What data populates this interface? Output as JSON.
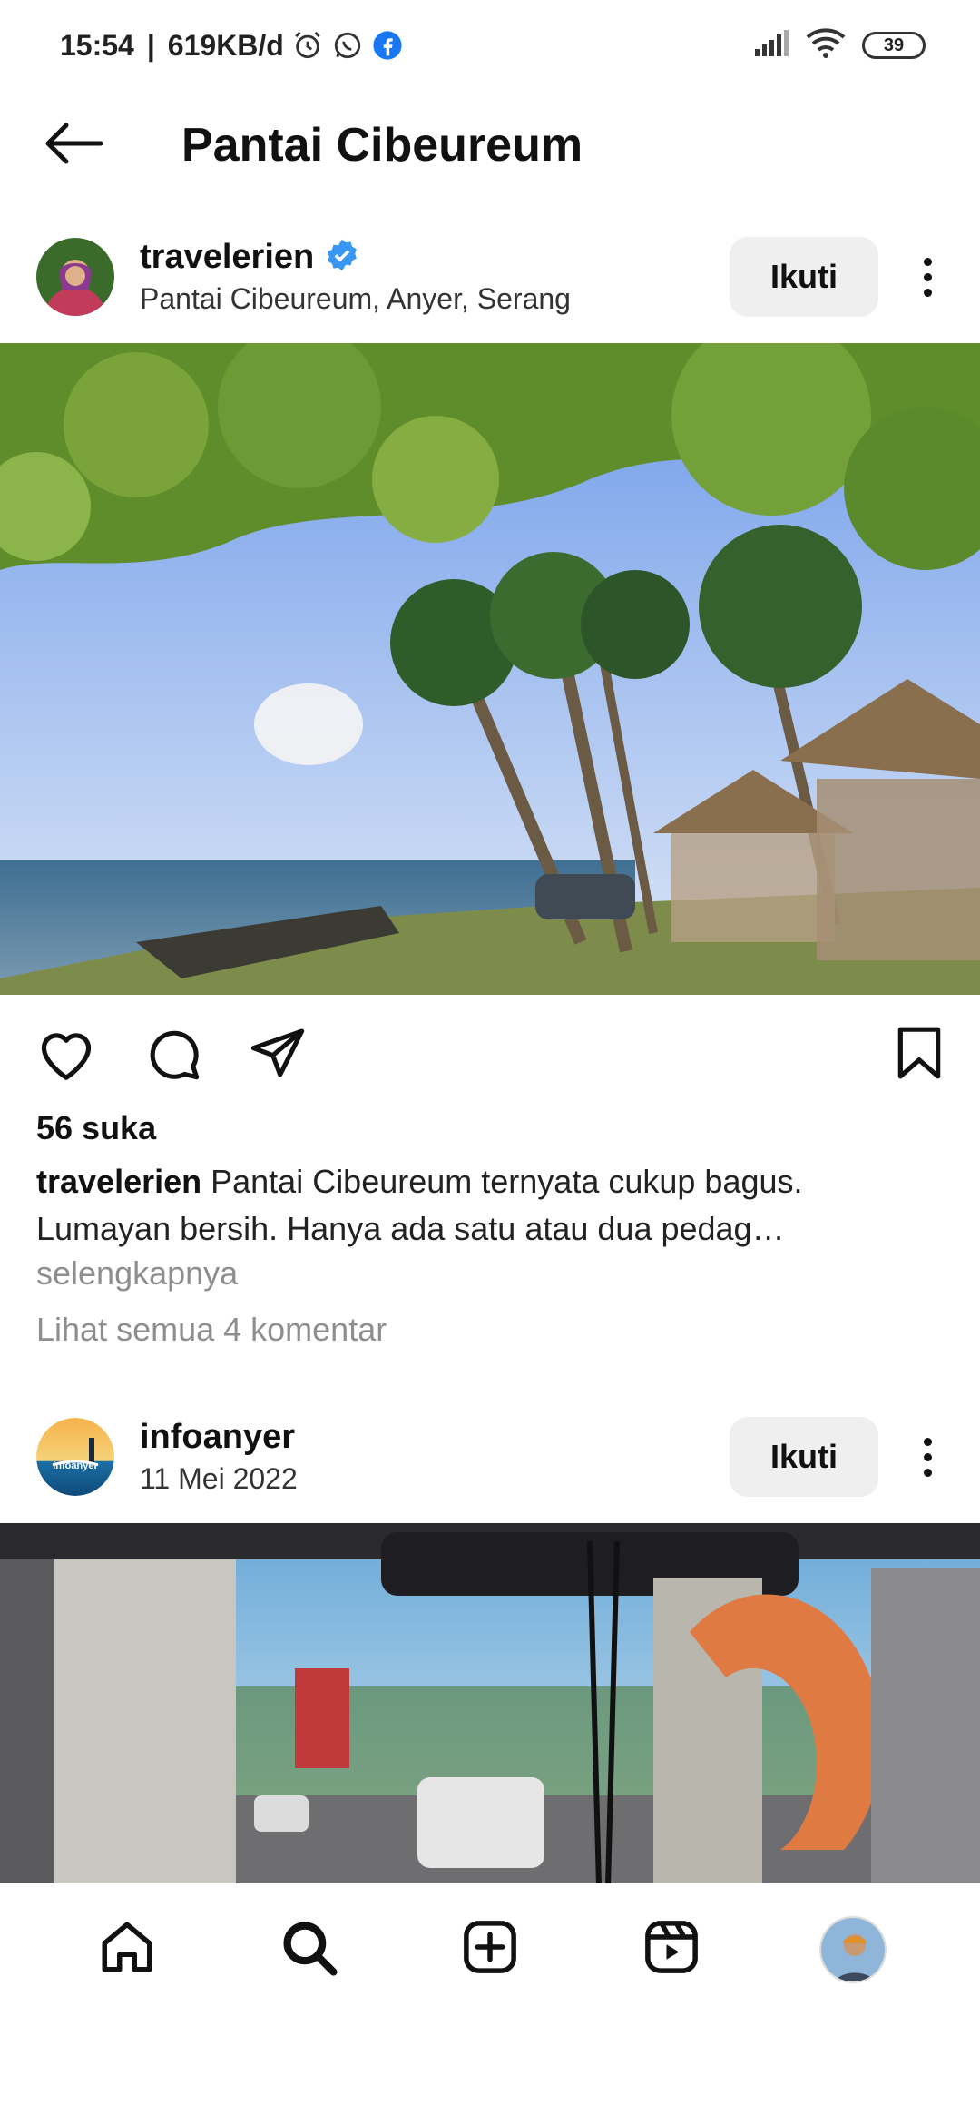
{
  "status_bar": {
    "time": "15:54",
    "separator": "|",
    "speed": "619KB/d",
    "icons": [
      "alarm-icon",
      "whatsapp-icon",
      "facebook-icon",
      "signal-icon",
      "wifi-icon"
    ],
    "battery": "39"
  },
  "header": {
    "title": "Pantai Cibeureum",
    "back_icon": "arrow-left-icon"
  },
  "posts": [
    {
      "username": "travelerien",
      "verified": true,
      "location": "Pantai Cibeureum, Anyer, Serang",
      "follow_label": "Ikuti",
      "likes": "56 suka",
      "caption_user": "travelerien",
      "caption_text": " Pantai Cibeureum ternyata cukup bagus. Lumayan bersih. Hanya ada satu atau dua pedag…",
      "more_label": "selengkapnya",
      "comments_label": "Lihat semua 4 komentar"
    },
    {
      "username": "infoanyer",
      "verified": false,
      "date": "11 Mei 2022",
      "follow_label": "Ikuti",
      "avatar_text": "infoanyer"
    }
  ],
  "actions": [
    "heart-icon",
    "comment-icon",
    "share-icon",
    "bookmark-icon"
  ],
  "bottom_nav": [
    "home-icon",
    "search-icon",
    "create-icon",
    "reels-icon",
    "profile-avatar"
  ],
  "colors": {
    "verified": "#3897f0",
    "follow_bg": "#efefef",
    "muted_text": "#8e8e8e",
    "facebook": "#1877f2"
  }
}
